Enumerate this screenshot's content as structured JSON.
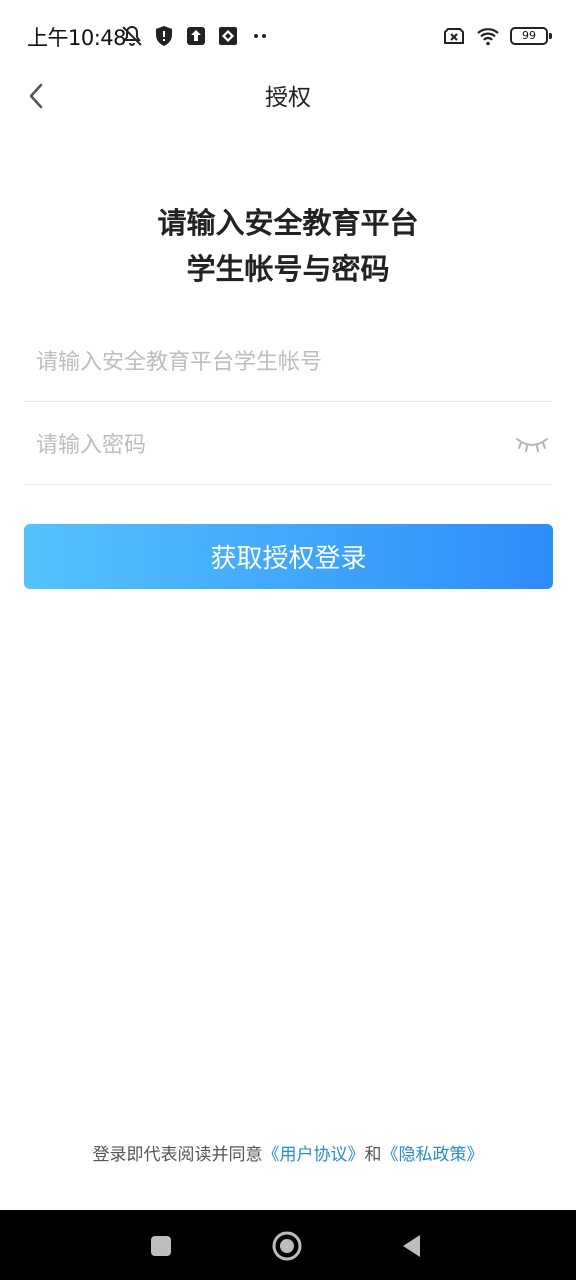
{
  "status_bar": {
    "time": "上午10:48",
    "battery": "99",
    "icons": [
      "bell-off-icon",
      "shield-icon",
      "upload-icon",
      "app-icon",
      "more-dots-icon",
      "sim-none-icon",
      "wifi-icon",
      "battery-icon"
    ]
  },
  "header": {
    "title": "授权",
    "back_icon": "chevron-left-icon"
  },
  "main": {
    "heading_line1": "请输入安全教育平台",
    "heading_line2": "学生帐号与密码",
    "account_placeholder": "请输入安全教育平台学生帐号",
    "account_value": "",
    "password_placeholder": "请输入密码",
    "password_value": "",
    "password_toggle_icon": "eye-closed-icon",
    "login_button": "获取授权登录",
    "button_gradient": [
      "#54c3fb",
      "#2e8cfb"
    ]
  },
  "footer": {
    "agreement_prefix": "登录即代表阅读并同意",
    "user_agreement": "《用户协议》",
    "and": "和",
    "privacy_policy": "《隐私政策》",
    "link_color": "#2a8cc8"
  },
  "nav_bar": {
    "icons": [
      "recent-apps-icon",
      "home-icon",
      "back-triangle-icon"
    ]
  }
}
